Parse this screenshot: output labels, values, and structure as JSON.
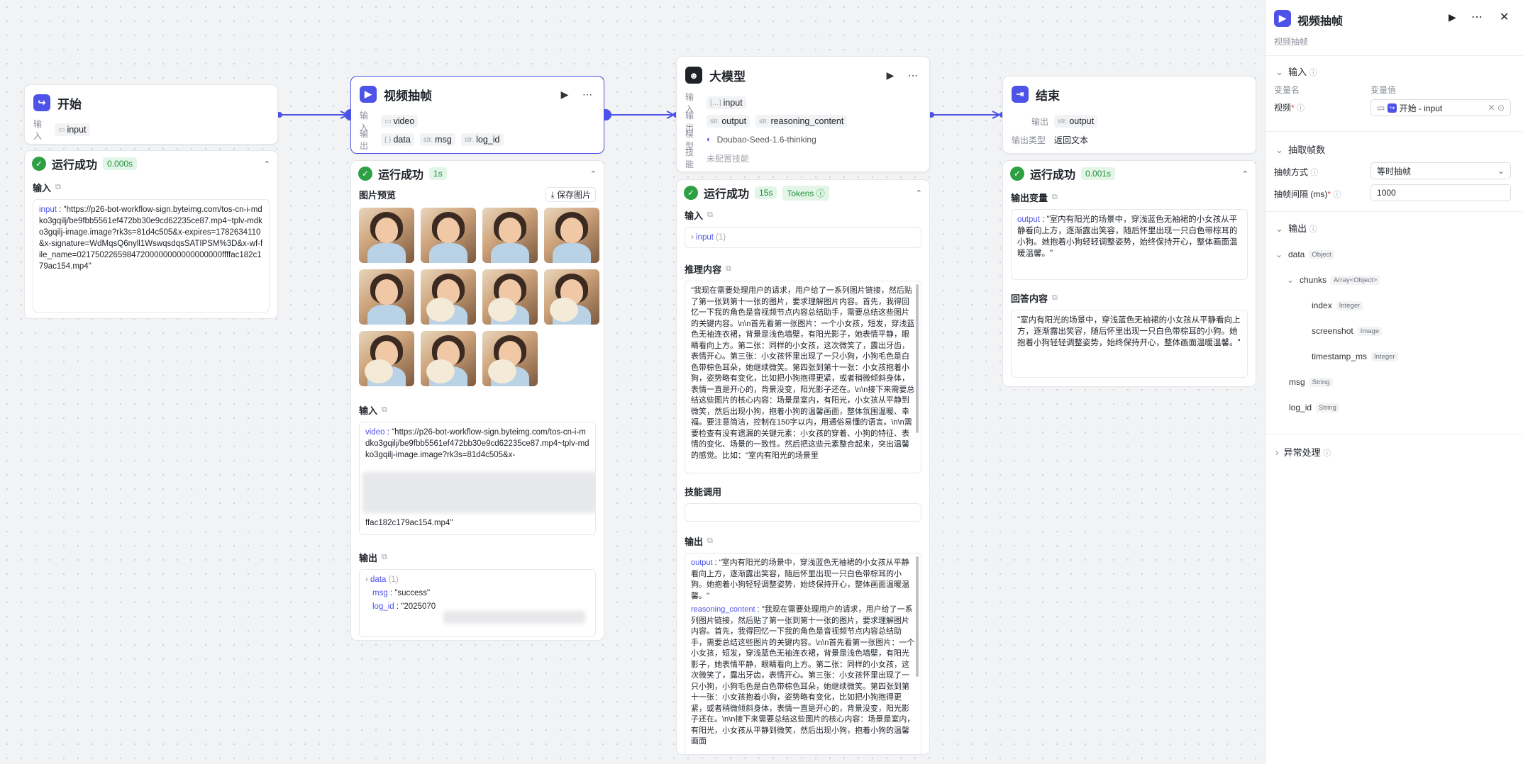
{
  "start": {
    "title": "开始",
    "in_label": "输入",
    "var": "input",
    "run": {
      "title": "运行成功",
      "time": "0.000s",
      "input_label": "输入",
      "key": "input",
      "value": "\"https://p26-bot-workflow-sign.byteimg.com/tos-cn-i-mdko3gqilj/be9fbb5561ef472bb30e9cd62235ce87.mp4~tplv-mdko3gqilj-image.image?rk3s=81d4c505&x-expires=1782634110&x-signature=WdMqsQ6nyll1WswqsdqsSATIPSM%3D&x-wf-file_name=02175022659847200000000000000000ffffac182c179ac154.mp4\""
    }
  },
  "extract": {
    "title": "视频抽帧",
    "in_label": "输入",
    "out_label": "输出",
    "in_var": "video",
    "outs": [
      {
        "t": "{ }",
        "n": "data"
      },
      {
        "t": "str.",
        "n": "msg"
      },
      {
        "t": "str.",
        "n": "log_id"
      }
    ],
    "run": {
      "title": "运行成功",
      "time": "1s",
      "preview": "图片预览",
      "save": "保存图片",
      "input_label": "输入",
      "key": "video",
      "value": "\"https://p26-bot-workflow-sign.byteimg.com/tos-cn-i-mdko3gqilj/be9fbb5561ef472bb30e9cd62235ce87.mp4~tplv-mdko3gqilj-image.image?rk3s=81d4c505&x-",
      "tail": "ffac182c179ac154.mp4\"",
      "output_label": "输出",
      "o_data": "data",
      "o_data_count": "(1)",
      "o_msg_key": "msg",
      "o_msg": "\"success\"",
      "o_log_key": "log_id",
      "o_log": "\"2025070"
    }
  },
  "llm": {
    "title": "大模型",
    "in_label": "输入",
    "out_label": "输出",
    "model_label": "模型",
    "skill_label": "技能",
    "in_var": "input",
    "outs": [
      "output",
      "reasoning_content"
    ],
    "model": "Doubao-Seed-1.6-thinking",
    "skill": "未配置技能",
    "run": {
      "title": "运行成功",
      "time": "15s",
      "tokens": "Tokens",
      "input_label": "输入",
      "input_key": "input",
      "input_count": "(1)",
      "reason_label": "推理内容",
      "reason": "\"我现在需要处理用户的请求，用户给了一系列图片链接，然后贴了第一张到第十一张的图片，要求理解图片内容。首先，我得回忆一下我的角色是音视频节点内容总结助手，需要总结这些图片的关键内容。\\n\\n首先看第一张图片：一个小女孩，短发，穿浅蓝色无袖连衣裙，背景是浅色墙壁，有阳光影子，她表情平静，眼睛看向上方。第二张：同样的小女孩，这次微笑了，露出牙齿，表情开心。第三张：小女孩怀里出现了一只小狗，小狗毛色是白色带棕色耳朵，她继续微笑。第四张到第十一张：小女孩抱着小狗，姿势略有变化，比如把小狗抱得更紧，或者稍微倾斜身体，表情一直是开心的，背景没变，阳光影子还在。\\n\\n接下来需要总结这些图片的核心内容：场景是室内，有阳光，小女孩从平静到微笑，然后出现小狗，抱着小狗的温馨画面，整体氛围温暖、幸福。要注意简洁，控制在150字以内，用通俗易懂的语言。\\n\\n需要检查有没有遗漏的关键元素：小女孩的穿着、小狗的特征、表情的变化、场景的一致性。然后把这些元素整合起来，突出温馨的感觉。比如：\"室内有阳光的场景里",
      "skill_label": "技能调用",
      "output_label": "输出",
      "out_key": "output",
      "out_val": "\"室内有阳光的场景中，穿浅蓝色无袖裙的小女孩从平静看向上方，逐渐露出笑容，随后怀里出现一只白色带棕耳的小狗。她抱着小狗轻轻调整姿势，始终保持开心，整体画面温暖温馨。\"",
      "rc_key": "reasoning_content",
      "rc_val": "\"我现在需要处理用户的请求，用户给了一系列图片链接，然后贴了第一张到第十一张的图片，要求理解图片内容。首先，我得回忆一下我的角色是音视频节点内容总结助手，需要总结这些图片的关键内容。\\n\\n首先看第一张图片：一个小女孩，短发，穿浅蓝色无袖连衣裙，背景是浅色墙壁，有阳光影子，她表情平静，眼睛看向上方。第二张：同样的小女孩，这次微笑了，露出牙齿，表情开心。第三张：小女孩怀里出现了一只小狗，小狗毛色是白色带棕色耳朵，她继续微笑。第四张到第十一张：小女孩抱着小狗，姿势略有变化，比如把小狗抱得更紧，或者稍微倾斜身体，表情一直是开心的，背景没变，阳光影子还在。\\n\\n接下来需要总结这些图片的核心内容：场景是室内，有阳光，小女孩从平静到微笑，然后出现小狗，抱着小狗的温馨画面"
    }
  },
  "end": {
    "title": "结束",
    "out_label": "输出",
    "type_label": "输出类型",
    "var": "output",
    "type": "返回文本",
    "run": {
      "title": "运行成功",
      "time": "0.001s",
      "outvar_label": "输出变量",
      "key": "output",
      "value": "\"室内有阳光的场景中，穿浅蓝色无袖裙的小女孩从平静看向上方，逐渐露出笑容，随后怀里出现一只白色带棕耳的小狗。她抱着小狗轻轻调整姿势，始终保持开心，整体画面温暖温馨。\"",
      "answer_label": "回答内容",
      "answer": "\"室内有阳光的场景中，穿浅蓝色无袖裙的小女孩从平静看向上方，逐渐露出笑容，随后怀里出现一只白色带棕耳的小狗。她抱着小狗轻轻调整姿势，始终保持开心，整体画面温暖温馨。\""
    }
  },
  "panel": {
    "title": "视频抽帧",
    "subtitle": "视频抽帧",
    "input_sec": "输入",
    "col_name": "变量名",
    "col_value": "变量值",
    "video_label": "视频",
    "video_ref": "开始 - input",
    "extract_sec": "抽取帧数",
    "mode_label": "抽帧方式",
    "mode_value": "等时抽帧",
    "interval_label": "抽帧间隔 (ms)",
    "interval_value": "1000",
    "output_sec": "输出",
    "tree": [
      {
        "n": "data",
        "t": "Object"
      },
      {
        "n": "chunks",
        "t": "Array<Object>"
      },
      {
        "n": "index",
        "t": "Integer"
      },
      {
        "n": "screenshot",
        "t": "Image"
      },
      {
        "n": "timestamp_ms",
        "t": "Integer"
      },
      {
        "n": "msg",
        "t": "String"
      },
      {
        "n": "log_id",
        "t": "String"
      }
    ],
    "error_sec": "异常处理"
  },
  "colors": {
    "accent": "#4d53e8",
    "success": "#2ea043"
  }
}
